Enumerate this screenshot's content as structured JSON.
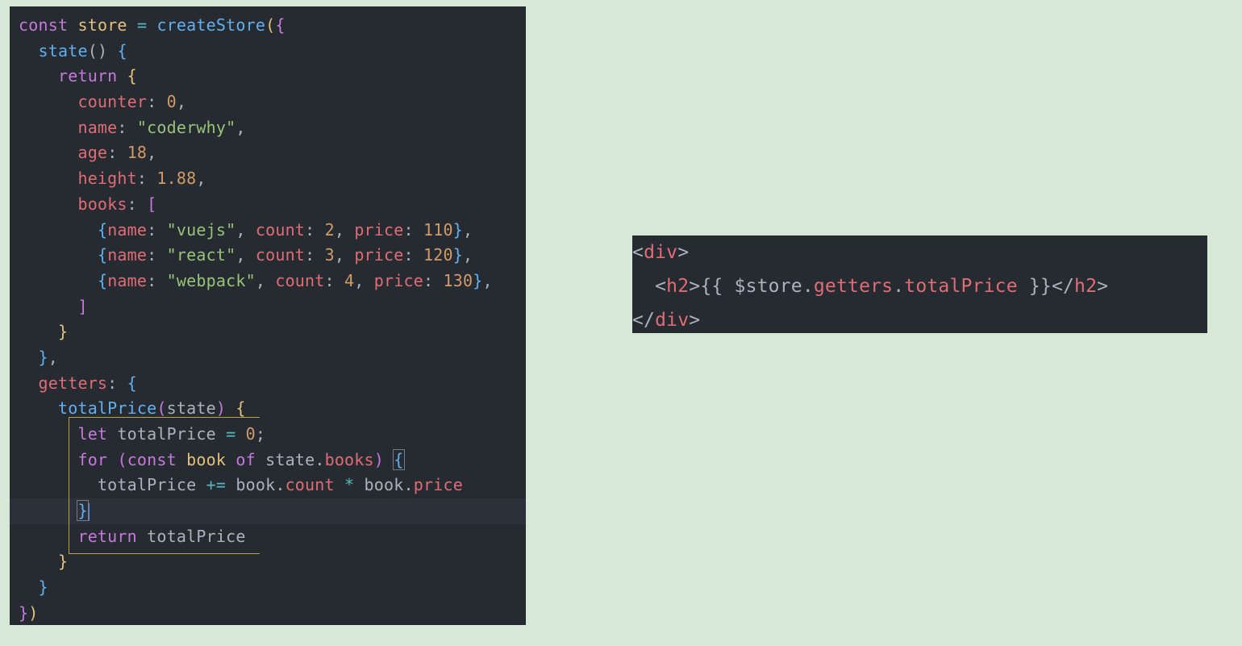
{
  "left_code": {
    "lines": [
      {
        "tokens": [
          {
            "t": "const",
            "c": "kw"
          },
          {
            "t": " ",
            "c": "ws"
          },
          {
            "t": "store",
            "c": "var"
          },
          {
            "t": " ",
            "c": "ws"
          },
          {
            "t": "=",
            "c": "op"
          },
          {
            "t": " ",
            "c": "ws"
          },
          {
            "t": "createStore",
            "c": "fn"
          },
          {
            "t": "(",
            "c": "b1"
          },
          {
            "t": "{",
            "c": "b2"
          }
        ]
      },
      {
        "tokens": [
          {
            "t": "  ",
            "c": "ws"
          },
          {
            "t": "state",
            "c": "fn"
          },
          {
            "t": "()",
            "c": "pun"
          },
          {
            "t": " ",
            "c": "ws"
          },
          {
            "t": "{",
            "c": "b3"
          }
        ]
      },
      {
        "tokens": [
          {
            "t": "    ",
            "c": "ws"
          },
          {
            "t": "return",
            "c": "kw"
          },
          {
            "t": " ",
            "c": "ws"
          },
          {
            "t": "{",
            "c": "b1"
          }
        ]
      },
      {
        "tokens": [
          {
            "t": "      ",
            "c": "ws"
          },
          {
            "t": "counter",
            "c": "prop"
          },
          {
            "t": ":",
            "c": "pun"
          },
          {
            "t": " ",
            "c": "ws"
          },
          {
            "t": "0",
            "c": "num"
          },
          {
            "t": ",",
            "c": "pun"
          }
        ]
      },
      {
        "tokens": [
          {
            "t": "      ",
            "c": "ws"
          },
          {
            "t": "name",
            "c": "prop"
          },
          {
            "t": ":",
            "c": "pun"
          },
          {
            "t": " ",
            "c": "ws"
          },
          {
            "t": "\"coderwhy\"",
            "c": "str"
          },
          {
            "t": ",",
            "c": "pun"
          }
        ]
      },
      {
        "tokens": [
          {
            "t": "      ",
            "c": "ws"
          },
          {
            "t": "age",
            "c": "prop"
          },
          {
            "t": ":",
            "c": "pun"
          },
          {
            "t": " ",
            "c": "ws"
          },
          {
            "t": "18",
            "c": "num"
          },
          {
            "t": ",",
            "c": "pun"
          }
        ]
      },
      {
        "tokens": [
          {
            "t": "      ",
            "c": "ws"
          },
          {
            "t": "height",
            "c": "prop"
          },
          {
            "t": ":",
            "c": "pun"
          },
          {
            "t": " ",
            "c": "ws"
          },
          {
            "t": "1.88",
            "c": "num"
          },
          {
            "t": ",",
            "c": "pun"
          }
        ]
      },
      {
        "tokens": [
          {
            "t": "      ",
            "c": "ws"
          },
          {
            "t": "books",
            "c": "prop"
          },
          {
            "t": ":",
            "c": "pun"
          },
          {
            "t": " ",
            "c": "ws"
          },
          {
            "t": "[",
            "c": "b2"
          }
        ]
      },
      {
        "tokens": [
          {
            "t": "        ",
            "c": "ws"
          },
          {
            "t": "{",
            "c": "b3"
          },
          {
            "t": "name",
            "c": "prop"
          },
          {
            "t": ":",
            "c": "pun"
          },
          {
            "t": " ",
            "c": "ws"
          },
          {
            "t": "\"vuejs\"",
            "c": "str"
          },
          {
            "t": ",",
            "c": "pun"
          },
          {
            "t": " ",
            "c": "ws"
          },
          {
            "t": "count",
            "c": "prop"
          },
          {
            "t": ":",
            "c": "pun"
          },
          {
            "t": " ",
            "c": "ws"
          },
          {
            "t": "2",
            "c": "num"
          },
          {
            "t": ",",
            "c": "pun"
          },
          {
            "t": " ",
            "c": "ws"
          },
          {
            "t": "price",
            "c": "prop"
          },
          {
            "t": ":",
            "c": "pun"
          },
          {
            "t": " ",
            "c": "ws"
          },
          {
            "t": "110",
            "c": "num"
          },
          {
            "t": "}",
            "c": "b3"
          },
          {
            "t": ",",
            "c": "pun"
          }
        ]
      },
      {
        "tokens": [
          {
            "t": "        ",
            "c": "ws"
          },
          {
            "t": "{",
            "c": "b3"
          },
          {
            "t": "name",
            "c": "prop"
          },
          {
            "t": ":",
            "c": "pun"
          },
          {
            "t": " ",
            "c": "ws"
          },
          {
            "t": "\"react\"",
            "c": "str"
          },
          {
            "t": ",",
            "c": "pun"
          },
          {
            "t": " ",
            "c": "ws"
          },
          {
            "t": "count",
            "c": "prop"
          },
          {
            "t": ":",
            "c": "pun"
          },
          {
            "t": " ",
            "c": "ws"
          },
          {
            "t": "3",
            "c": "num"
          },
          {
            "t": ",",
            "c": "pun"
          },
          {
            "t": " ",
            "c": "ws"
          },
          {
            "t": "price",
            "c": "prop"
          },
          {
            "t": ":",
            "c": "pun"
          },
          {
            "t": " ",
            "c": "ws"
          },
          {
            "t": "120",
            "c": "num"
          },
          {
            "t": "}",
            "c": "b3"
          },
          {
            "t": ",",
            "c": "pun"
          }
        ]
      },
      {
        "tokens": [
          {
            "t": "        ",
            "c": "ws"
          },
          {
            "t": "{",
            "c": "b3"
          },
          {
            "t": "name",
            "c": "prop"
          },
          {
            "t": ":",
            "c": "pun"
          },
          {
            "t": " ",
            "c": "ws"
          },
          {
            "t": "\"webpack\"",
            "c": "str"
          },
          {
            "t": ",",
            "c": "pun"
          },
          {
            "t": " ",
            "c": "ws"
          },
          {
            "t": "count",
            "c": "prop"
          },
          {
            "t": ":",
            "c": "pun"
          },
          {
            "t": " ",
            "c": "ws"
          },
          {
            "t": "4",
            "c": "num"
          },
          {
            "t": ",",
            "c": "pun"
          },
          {
            "t": " ",
            "c": "ws"
          },
          {
            "t": "price",
            "c": "prop"
          },
          {
            "t": ":",
            "c": "pun"
          },
          {
            "t": " ",
            "c": "ws"
          },
          {
            "t": "130",
            "c": "num"
          },
          {
            "t": "}",
            "c": "b3"
          },
          {
            "t": ",",
            "c": "pun"
          }
        ]
      },
      {
        "tokens": [
          {
            "t": "      ",
            "c": "ws"
          },
          {
            "t": "]",
            "c": "b2"
          }
        ]
      },
      {
        "tokens": [
          {
            "t": "    ",
            "c": "ws"
          },
          {
            "t": "}",
            "c": "b1"
          }
        ]
      },
      {
        "tokens": [
          {
            "t": "  ",
            "c": "ws"
          },
          {
            "t": "}",
            "c": "b3"
          },
          {
            "t": ",",
            "c": "pun"
          }
        ]
      },
      {
        "tokens": [
          {
            "t": "  ",
            "c": "ws"
          },
          {
            "t": "getters",
            "c": "prop"
          },
          {
            "t": ":",
            "c": "pun"
          },
          {
            "t": " ",
            "c": "ws"
          },
          {
            "t": "{",
            "c": "b3"
          }
        ]
      },
      {
        "tokens": [
          {
            "t": "    ",
            "c": "ws"
          },
          {
            "t": "totalPrice",
            "c": "fn"
          },
          {
            "t": "(",
            "c": "b2"
          },
          {
            "t": "state",
            "c": "txt"
          },
          {
            "t": ")",
            "c": "b2"
          },
          {
            "t": " ",
            "c": "ws"
          },
          {
            "t": "{",
            "c": "b1"
          }
        ]
      },
      {
        "tokens": [
          {
            "t": "      ",
            "c": "ws"
          },
          {
            "t": "let",
            "c": "kw"
          },
          {
            "t": " ",
            "c": "ws"
          },
          {
            "t": "totalPrice",
            "c": "txt"
          },
          {
            "t": " ",
            "c": "ws"
          },
          {
            "t": "=",
            "c": "op"
          },
          {
            "t": " ",
            "c": "ws"
          },
          {
            "t": "0",
            "c": "num"
          },
          {
            "t": ";",
            "c": "pun"
          }
        ]
      },
      {
        "tokens": [
          {
            "t": "      ",
            "c": "ws"
          },
          {
            "t": "for",
            "c": "kw"
          },
          {
            "t": " ",
            "c": "ws"
          },
          {
            "t": "(",
            "c": "b2"
          },
          {
            "t": "const",
            "c": "kw"
          },
          {
            "t": " ",
            "c": "ws"
          },
          {
            "t": "book",
            "c": "var"
          },
          {
            "t": " ",
            "c": "ws"
          },
          {
            "t": "of",
            "c": "kw"
          },
          {
            "t": " ",
            "c": "ws"
          },
          {
            "t": "state",
            "c": "txt"
          },
          {
            "t": ".",
            "c": "pun"
          },
          {
            "t": "books",
            "c": "prop"
          },
          {
            "t": ")",
            "c": "b2"
          },
          {
            "t": " ",
            "c": "ws"
          },
          {
            "t": "{",
            "c": "b3",
            "box": true
          }
        ]
      },
      {
        "tokens": [
          {
            "t": "        ",
            "c": "ws"
          },
          {
            "t": "totalPrice",
            "c": "txt"
          },
          {
            "t": " ",
            "c": "ws"
          },
          {
            "t": "+=",
            "c": "op"
          },
          {
            "t": " ",
            "c": "ws"
          },
          {
            "t": "book",
            "c": "txt"
          },
          {
            "t": ".",
            "c": "pun"
          },
          {
            "t": "count",
            "c": "prop"
          },
          {
            "t": " ",
            "c": "ws"
          },
          {
            "t": "*",
            "c": "op"
          },
          {
            "t": " ",
            "c": "ws"
          },
          {
            "t": "book",
            "c": "txt"
          },
          {
            "t": ".",
            "c": "pun"
          },
          {
            "t": "price",
            "c": "prop"
          }
        ]
      },
      {
        "active": true,
        "tokens": [
          {
            "t": "      ",
            "c": "ws"
          },
          {
            "t": "}",
            "c": "b3",
            "box": true,
            "cursor": true
          }
        ]
      },
      {
        "tokens": [
          {
            "t": "      ",
            "c": "ws"
          },
          {
            "t": "return",
            "c": "kw"
          },
          {
            "t": " ",
            "c": "ws"
          },
          {
            "t": "totalPrice",
            "c": "txt"
          }
        ]
      },
      {
        "tokens": [
          {
            "t": "    ",
            "c": "ws"
          },
          {
            "t": "}",
            "c": "b1"
          }
        ]
      },
      {
        "tokens": [
          {
            "t": "  ",
            "c": "ws"
          },
          {
            "t": "}",
            "c": "b3"
          }
        ]
      },
      {
        "tokens": [
          {
            "t": "}",
            "c": "b2"
          },
          {
            "t": ")",
            "c": "b1"
          }
        ]
      }
    ]
  },
  "right_code": {
    "lines": [
      {
        "tokens": [
          {
            "t": "<",
            "c": "ang"
          },
          {
            "t": "div",
            "c": "tag"
          },
          {
            "t": ">",
            "c": "ang"
          }
        ]
      },
      {
        "tokens": [
          {
            "t": "  ",
            "c": "ws"
          },
          {
            "t": "<",
            "c": "ang"
          },
          {
            "t": "h2",
            "c": "tag"
          },
          {
            "t": ">",
            "c": "ang"
          },
          {
            "t": "{{",
            "c": "pun"
          },
          {
            "t": " ",
            "c": "ws"
          },
          {
            "t": "$store",
            "c": "txt"
          },
          {
            "t": ".",
            "c": "pun"
          },
          {
            "t": "getters",
            "c": "prop"
          },
          {
            "t": ".",
            "c": "pun"
          },
          {
            "t": "totalPrice",
            "c": "prop"
          },
          {
            "t": " ",
            "c": "ws"
          },
          {
            "t": "}}",
            "c": "pun"
          },
          {
            "t": "</",
            "c": "ang"
          },
          {
            "t": "h2",
            "c": "tag"
          },
          {
            "t": ">",
            "c": "ang"
          }
        ]
      },
      {
        "tokens": [
          {
            "t": "</",
            "c": "ang"
          },
          {
            "t": "div",
            "c": "tag"
          },
          {
            "t": ">",
            "c": "ang"
          }
        ]
      }
    ]
  }
}
